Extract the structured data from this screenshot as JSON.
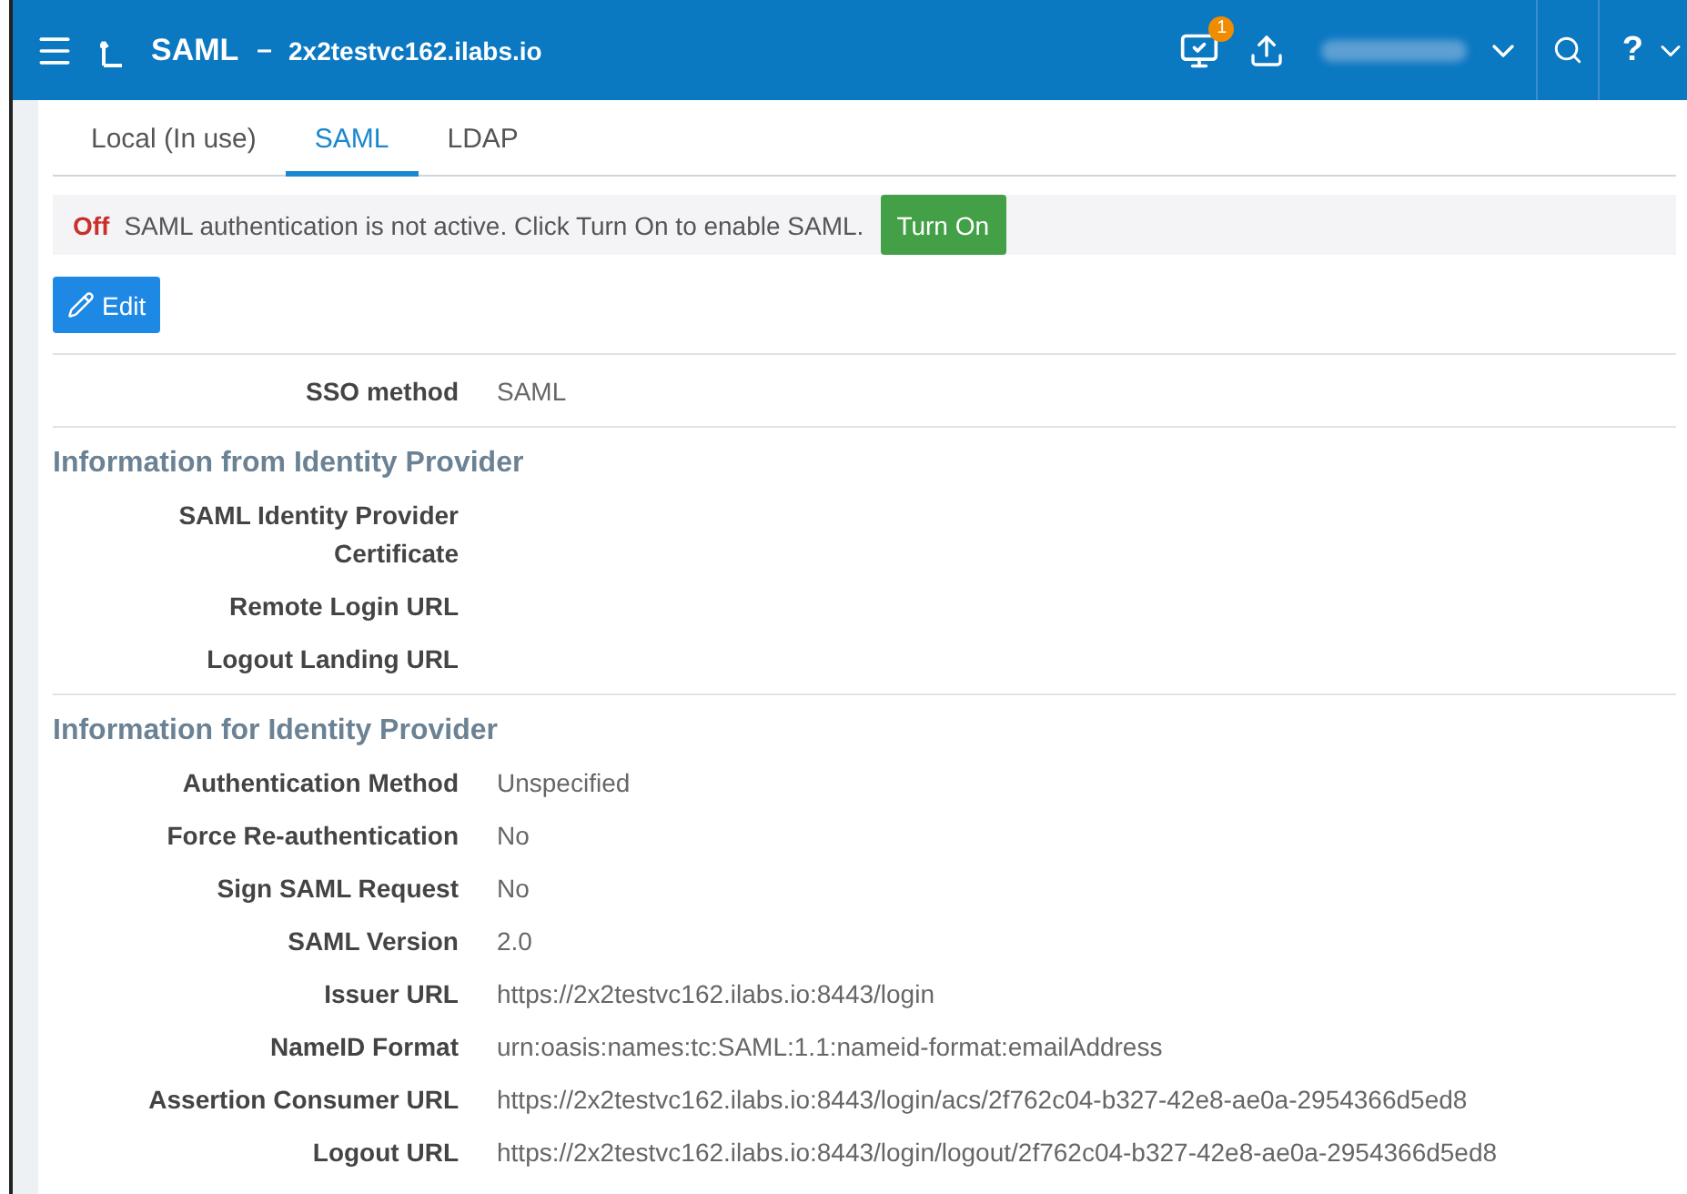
{
  "header": {
    "title": "SAML",
    "separator": "–",
    "host": "2x2testvc162.ilabs.io",
    "notification_count": "1",
    "help_label": "?"
  },
  "tabs": [
    {
      "label": "Local (In use)",
      "selected": false
    },
    {
      "label": "SAML",
      "selected": true
    },
    {
      "label": "LDAP",
      "selected": false
    }
  ],
  "status_banner": {
    "state": "Off",
    "message": "SAML authentication is not active. Click Turn On to enable SAML.",
    "button": "Turn On"
  },
  "edit_button": "Edit",
  "sections": [
    {
      "rows": [
        {
          "label": "SSO method",
          "value": "SAML"
        }
      ]
    },
    {
      "heading": "Information from Identity Provider",
      "rows": [
        {
          "label": "SAML Identity Provider Certificate"
        },
        {
          "label": "Remote Login URL"
        },
        {
          "label": "Logout Landing URL"
        }
      ]
    },
    {
      "heading": "Information for Identity Provider",
      "rows": [
        {
          "label": "Authentication Method",
          "value": "Unspecified"
        },
        {
          "label": "Force Re-authentication",
          "value": "No"
        },
        {
          "label": "Sign SAML Request",
          "value": "No"
        },
        {
          "label": "SAML Version",
          "value": "2.0"
        },
        {
          "label": "Issuer URL",
          "value": "https://2x2testvc162.ilabs.io:8443/login"
        },
        {
          "label": "NameID Format",
          "value": "urn:oasis:names:tc:SAML:1.1:nameid-format:emailAddress"
        },
        {
          "label": "Assertion Consumer URL",
          "value": "https://2x2testvc162.ilabs.io:8443/login/acs/2f762c04-b327-42e8-ae0a-2954366d5ed8"
        },
        {
          "label": "Logout URL",
          "value": "https://2x2testvc162.ilabs.io:8443/login/logout/2f762c04-b327-42e8-ae0a-2954366d5ed8"
        }
      ]
    }
  ]
}
